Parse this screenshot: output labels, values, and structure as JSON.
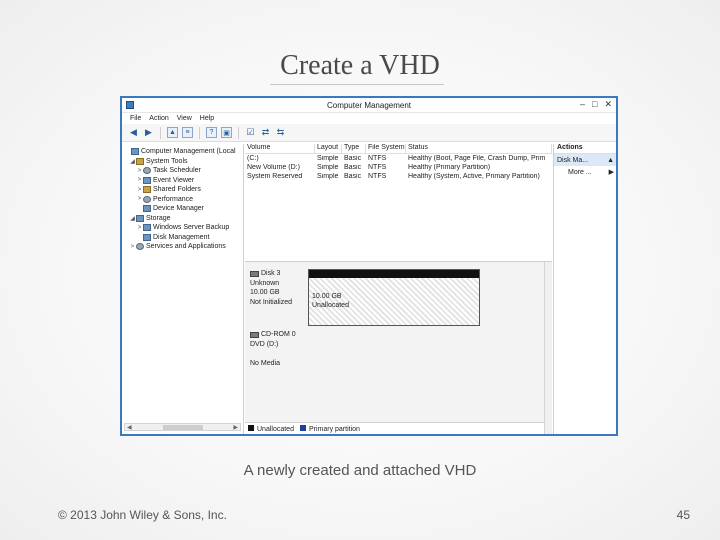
{
  "slide": {
    "title": "Create a VHD",
    "caption": "A newly created and attached VHD",
    "footer": "© 2013 John Wiley & Sons, Inc.",
    "page_number": "45"
  },
  "window": {
    "title": "Computer Management",
    "controls": {
      "minimize": "–",
      "maximize": "□",
      "close": "✕"
    },
    "menu": [
      "File",
      "Action",
      "View",
      "Help"
    ],
    "toolbar_icons": [
      "back-arrow-icon",
      "forward-arrow-icon",
      "folder-up-icon",
      "properties-icon",
      "help-icon",
      "console-icon",
      "checklist-icon",
      "connect-icon",
      "disconnect-icon"
    ]
  },
  "tree": {
    "items": [
      {
        "label": "Computer Management (Local",
        "indent": 0,
        "expander": "",
        "icon": "computer-icon"
      },
      {
        "label": "System Tools",
        "indent": 1,
        "expander": "◢",
        "icon": "tools-icon"
      },
      {
        "label": "Task Scheduler",
        "indent": 2,
        "expander": ">",
        "icon": "clock-icon"
      },
      {
        "label": "Event Viewer",
        "indent": 2,
        "expander": ">",
        "icon": "event-viewer-icon"
      },
      {
        "label": "Shared Folders",
        "indent": 2,
        "expander": ">",
        "icon": "shared-folder-icon"
      },
      {
        "label": "Performance",
        "indent": 2,
        "expander": ">",
        "icon": "performance-icon"
      },
      {
        "label": "Device Manager",
        "indent": 2,
        "expander": "",
        "icon": "device-manager-icon"
      },
      {
        "label": "Storage",
        "indent": 1,
        "expander": "◢",
        "icon": "storage-icon"
      },
      {
        "label": "Windows Server Backup",
        "indent": 2,
        "expander": ">",
        "icon": "backup-icon"
      },
      {
        "label": "Disk Management",
        "indent": 2,
        "expander": "",
        "icon": "disk-management-icon"
      },
      {
        "label": "Services and Applications",
        "indent": 1,
        "expander": ">",
        "icon": "services-icon"
      }
    ]
  },
  "volume_table": {
    "headers": [
      "Volume",
      "Layout",
      "Type",
      "File System",
      "Status"
    ],
    "rows": [
      [
        "(C:)",
        "Simple",
        "Basic",
        "NTFS",
        "Healthy (Boot, Page File, Crash Dump, Prim"
      ],
      [
        "New Volume (D:)",
        "Simple",
        "Basic",
        "NTFS",
        "Healthy (Primary Partition)"
      ],
      [
        "System Reserved",
        "Simple",
        "Basic",
        "NTFS",
        "Healthy (System, Active, Primary Partition)"
      ]
    ]
  },
  "disks": [
    {
      "name": "Disk 3",
      "type": "Unknown",
      "size": "10.00 GB",
      "status": "Not Initialized",
      "partition_size": "10.00 GB",
      "partition_state": "Unallocated"
    },
    {
      "name": "CD-ROM 0",
      "drive": "DVD (D:)",
      "media": "No Media"
    }
  ],
  "legend": [
    {
      "label": "Unallocated",
      "color": "#111111"
    },
    {
      "label": "Primary partition",
      "color": "#1f3f9c"
    }
  ],
  "actions": {
    "header": "Actions",
    "items": [
      {
        "label": "Disk Ma...",
        "arrow": "▲",
        "selected": true
      },
      {
        "label": "More ...",
        "arrow": "▶",
        "selected": false
      }
    ]
  },
  "colors": {
    "window_border": "#3a78c4",
    "selection": "#dbe8f6"
  }
}
